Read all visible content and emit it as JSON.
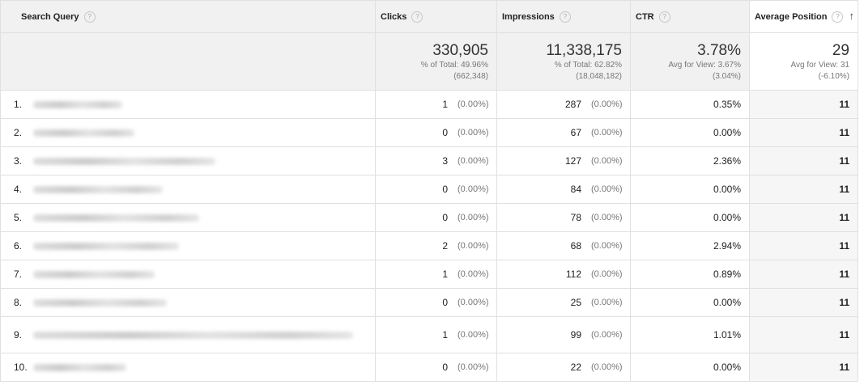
{
  "columns": [
    {
      "label": "Search Query"
    },
    {
      "label": "Clicks"
    },
    {
      "label": "Impressions"
    },
    {
      "label": "CTR"
    },
    {
      "label": "Average Position"
    }
  ],
  "summary": {
    "clicks": {
      "value": "330,905",
      "line1": "% of Total: 49.96%",
      "line2": "(662,348)"
    },
    "impressions": {
      "value": "11,338,175",
      "line1": "% of Total: 62.82%",
      "line2": "(18,048,182)"
    },
    "ctr": {
      "value": "3.78%",
      "line1": "Avg for View: 3.67%",
      "line2": "(3.04%)"
    },
    "position": {
      "value": "29",
      "line1": "Avg for View: 31",
      "line2": "(-6.10%)"
    }
  },
  "rows": [
    {
      "index": "1.",
      "clicks": "1",
      "clicks_pct": "(0.00%)",
      "impressions": "287",
      "impressions_pct": "(0.00%)",
      "ctr": "0.35%",
      "position": "11"
    },
    {
      "index": "2.",
      "clicks": "0",
      "clicks_pct": "(0.00%)",
      "impressions": "67",
      "impressions_pct": "(0.00%)",
      "ctr": "0.00%",
      "position": "11"
    },
    {
      "index": "3.",
      "clicks": "3",
      "clicks_pct": "(0.00%)",
      "impressions": "127",
      "impressions_pct": "(0.00%)",
      "ctr": "2.36%",
      "position": "11"
    },
    {
      "index": "4.",
      "clicks": "0",
      "clicks_pct": "(0.00%)",
      "impressions": "84",
      "impressions_pct": "(0.00%)",
      "ctr": "0.00%",
      "position": "11"
    },
    {
      "index": "5.",
      "clicks": "0",
      "clicks_pct": "(0.00%)",
      "impressions": "78",
      "impressions_pct": "(0.00%)",
      "ctr": "0.00%",
      "position": "11"
    },
    {
      "index": "6.",
      "clicks": "2",
      "clicks_pct": "(0.00%)",
      "impressions": "68",
      "impressions_pct": "(0.00%)",
      "ctr": "2.94%",
      "position": "11"
    },
    {
      "index": "7.",
      "clicks": "1",
      "clicks_pct": "(0.00%)",
      "impressions": "112",
      "impressions_pct": "(0.00%)",
      "ctr": "0.89%",
      "position": "11"
    },
    {
      "index": "8.",
      "clicks": "0",
      "clicks_pct": "(0.00%)",
      "impressions": "25",
      "impressions_pct": "(0.00%)",
      "ctr": "0.00%",
      "position": "11"
    },
    {
      "index": "9.",
      "clicks": "1",
      "clicks_pct": "(0.00%)",
      "impressions": "99",
      "impressions_pct": "(0.00%)",
      "ctr": "1.01%",
      "position": "11"
    },
    {
      "index": "10.",
      "clicks": "0",
      "clicks_pct": "(0.00%)",
      "impressions": "22",
      "impressions_pct": "(0.00%)",
      "ctr": "0.00%",
      "position": "11"
    }
  ],
  "icons": {
    "help": "question-mark-icon",
    "sort": "sort-up-arrow-icon"
  },
  "colors": {
    "header_bg": "#f1f1f1",
    "border": "#e0e0e0",
    "position_bg": "#f6f6f6"
  }
}
